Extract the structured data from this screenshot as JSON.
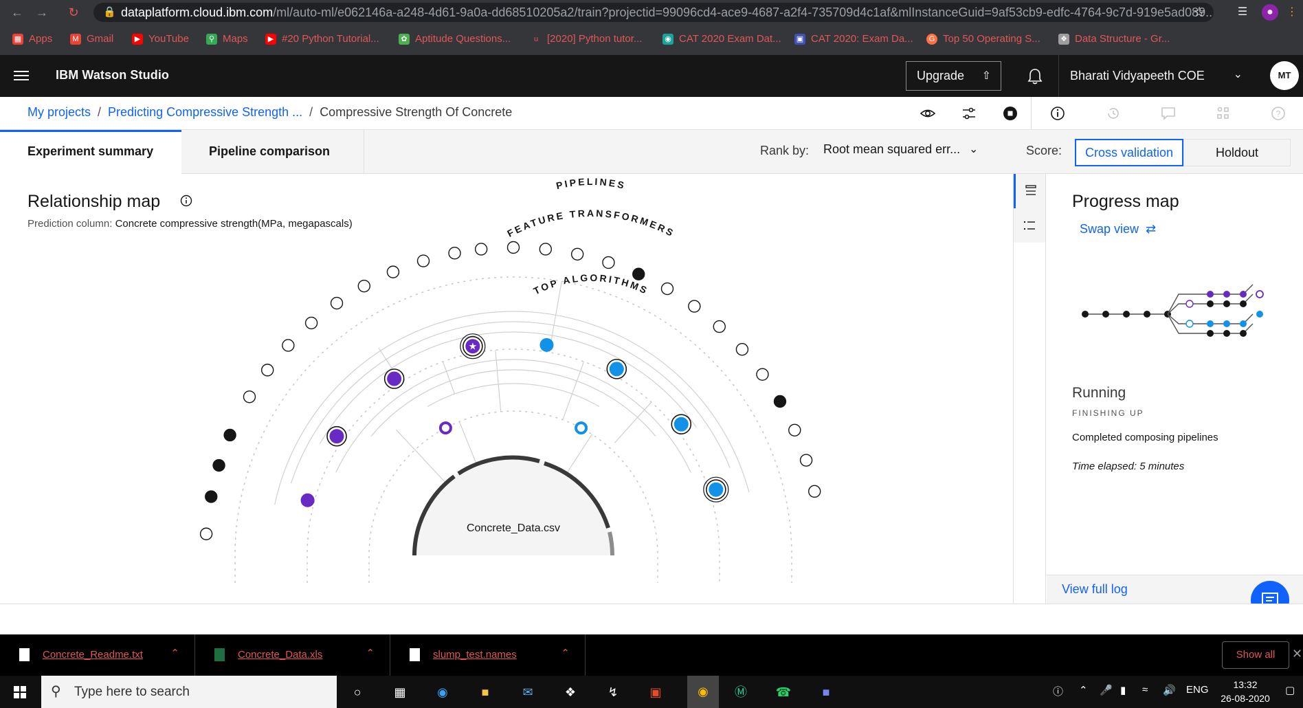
{
  "browser": {
    "url_host": "dataplatform.cloud.ibm.com",
    "url_path": "/ml/auto-ml/e062146a-a248-4d61-9a0a-dd68510205a2/train?projectid=99096cd4-ace9-4687-a2f4-735709d4c1af&mlInstanceGuid=9af53cb9-edfc-4764-9c7d-919e5ad089...",
    "bookmarks": [
      {
        "label": "Apps",
        "color": "#ea4335"
      },
      {
        "label": "Gmail",
        "color": "#ea4335"
      },
      {
        "label": "YouTube",
        "color": "#ff0000"
      },
      {
        "label": "Maps",
        "color": "#34a853"
      },
      {
        "label": "#20 Python Tutorial...",
        "color": "#ff0000"
      },
      {
        "label": "Aptitude Questions...",
        "color": "#4caf50"
      },
      {
        "label": "[2020] Python tutor...",
        "color": "#e25656"
      },
      {
        "label": "CAT 2020 Exam Dat...",
        "color": "#1aa39a"
      },
      {
        "label": "CAT 2020: Exam Da...",
        "color": "#3f51b5"
      },
      {
        "label": "Top 50 Operating S...",
        "color": "#ff7043"
      },
      {
        "label": "Data Structure - Gr...",
        "color": "#9e9e9e"
      }
    ]
  },
  "app": {
    "product": "IBM Watson Studio",
    "upgrade": "Upgrade",
    "account": "Bharati Vidyapeeth COE",
    "avatar_initials": "MT"
  },
  "breadcrumb": {
    "root": "My projects",
    "project": "Predicting Compressive Strength ...",
    "current": "Compressive Strength Of Concrete"
  },
  "tabs": {
    "summary": "Experiment summary",
    "comparison": "Pipeline comparison",
    "rank_label": "Rank by:",
    "rank_value": "Root mean squared err...",
    "score_label": "Score:",
    "score_cv": "Cross validation",
    "score_holdout": "Holdout"
  },
  "relationship_map": {
    "title": "Relationship map",
    "prediction_label": "Prediction column:",
    "prediction_value": "Concrete compressive strength(MPa, megapascals)",
    "ring_outer_label": "FEATURE TRANSFORMERS",
    "ring_middle_label": "PIPELINES",
    "ring_inner_label": "TOP ALGORITHMS",
    "center_label": "Concrete_Data.csv"
  },
  "progress_map": {
    "title": "Progress map",
    "swap_view": "Swap view",
    "status": "Running",
    "status_sub": "FINISHING UP",
    "detail": "Completed composing pipelines",
    "elapsed": "Time elapsed: 5 minutes",
    "view_log": "View full log"
  },
  "colors": {
    "purple": "#6929c4",
    "blue": "#1192e8",
    "black": "#161616",
    "link_blue": "#0f62fe"
  },
  "downloads": {
    "files": [
      "Concrete_Readme.txt",
      "Concrete_Data.xls",
      "slump_test.names"
    ],
    "show_all": "Show all"
  },
  "taskbar": {
    "search_placeholder": "Type here to search",
    "lang": "ENG",
    "time": "13:32",
    "date": "26-08-2020"
  }
}
